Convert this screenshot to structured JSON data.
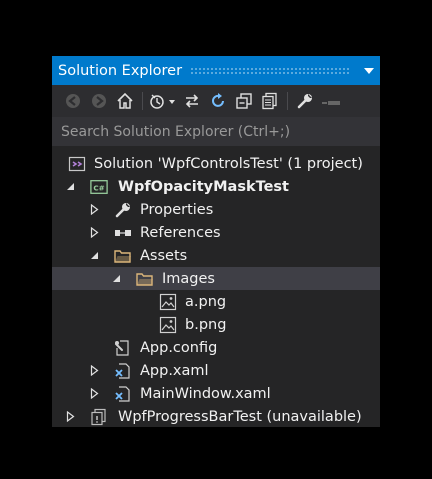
{
  "panel": {
    "title": "Solution Explorer"
  },
  "search": {
    "placeholder": "Search Solution Explorer (Ctrl+;)"
  },
  "tree": {
    "solution": "Solution 'WpfControlsTest' (1 project)",
    "project": "WpfOpacityMaskTest",
    "properties": "Properties",
    "references": "References",
    "assets": "Assets",
    "images": "Images",
    "a_png": "a.png",
    "b_png": "b.png",
    "app_config": "App.config",
    "app_xaml": "App.xaml",
    "mainwindow_xaml": "MainWindow.xaml",
    "progressbar_project": "WpfProgressBarTest (unavailable)"
  },
  "colors": {
    "accent": "#007acc",
    "panel_bg": "#252526",
    "toolbar_bg": "#2d2d30",
    "search_bg": "#333337",
    "selected_bg": "#3f3f46",
    "icon_blue": "#75beff",
    "csharp_green": "#9ad09e",
    "folder_orange": "#dcb67a"
  },
  "icons": [
    "back-icon",
    "forward-icon",
    "home-icon",
    "pending-changes-icon",
    "sync-icon",
    "refresh-icon",
    "collapse-all-icon",
    "show-all-files-icon",
    "properties-wrench-icon",
    "preview-icon"
  ]
}
